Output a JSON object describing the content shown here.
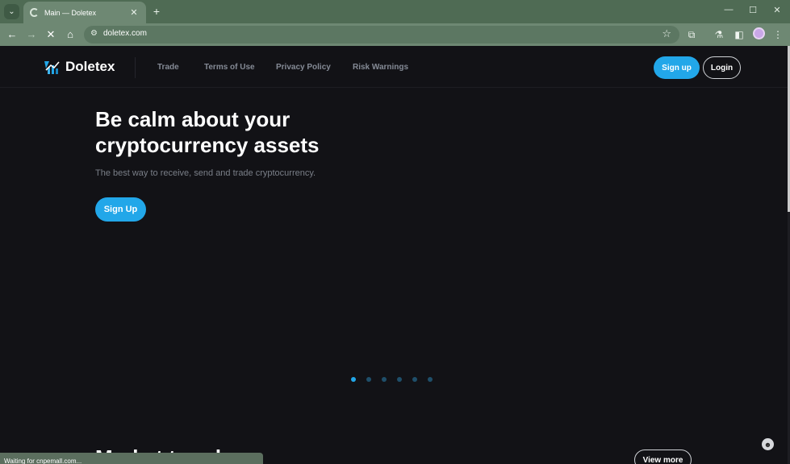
{
  "browser": {
    "tab_title": "Main — Doletex",
    "tab_close": "✕",
    "new_tab": "+",
    "url": "doletex.com",
    "status_text": "Waiting for cnpemall.com...",
    "icons": [
      "tab-list-icon",
      "loading-spinner-icon",
      "back-icon",
      "forward-icon",
      "stop-icon",
      "home-icon",
      "site-info-icon",
      "bookmark-star-icon",
      "extensions-icon",
      "labs-icon",
      "sidebar-icon",
      "profile-avatar",
      "menu-icon",
      "minimize-icon",
      "maximize-icon",
      "close-icon"
    ]
  },
  "site": {
    "brand": "Doletex",
    "nav": {
      "trade": "Trade",
      "terms": "Terms of Use",
      "privacy": "Privacy Policy",
      "risk": "Risk Warnings"
    },
    "signup_label": "Sign up",
    "login_label": "Login",
    "hero": {
      "title_line1": "Be calm about your",
      "title_line2": "cryptocurrency assets",
      "subtitle": "The best way to receive, send and trade cryptocurrency.",
      "cta_label": "Sign Up"
    },
    "carousel": {
      "slide_count": 6,
      "active_index": 0
    },
    "section_title": "Market trends",
    "view_more_label": "View more"
  },
  "colors": {
    "accent": "#22a7e9",
    "page_bg": "#121216",
    "chrome_frame": "#4f6b54",
    "chrome_toolbar": "#6e8873"
  }
}
